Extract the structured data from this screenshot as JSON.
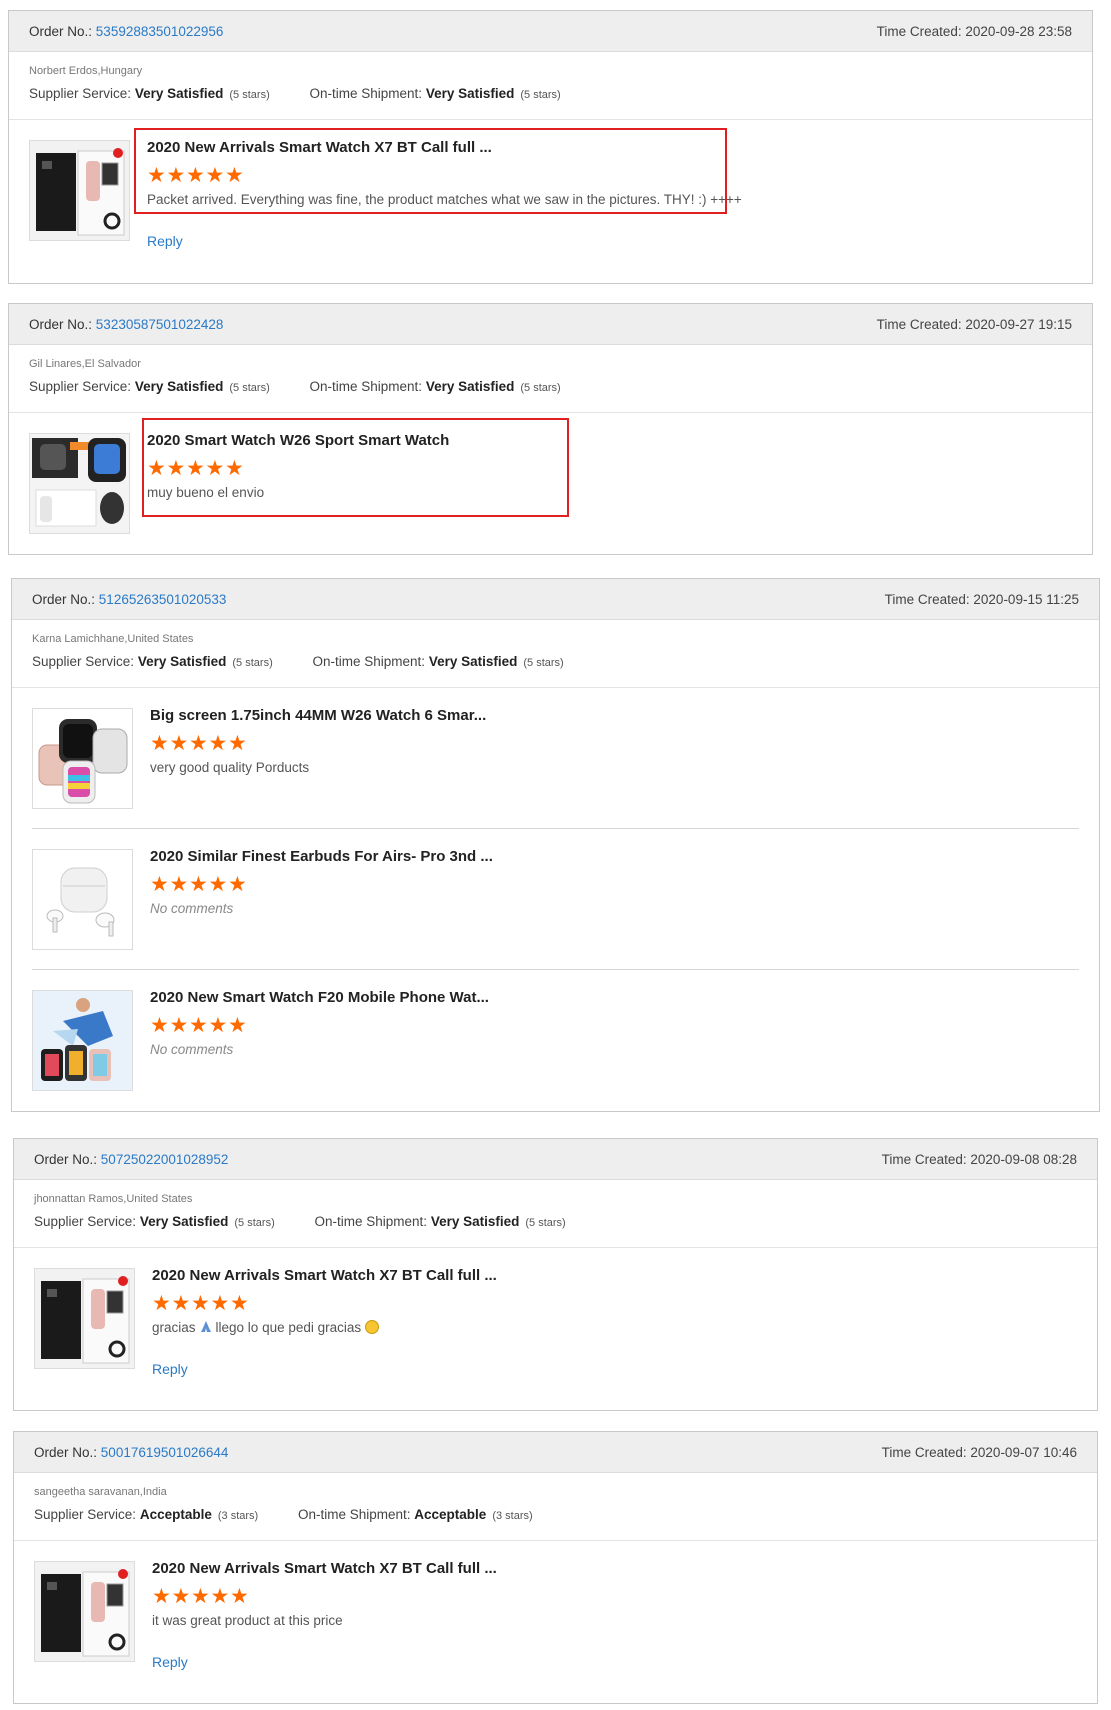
{
  "labels": {
    "order_no": "Order No.:",
    "time_created": "Time Created:",
    "supplier_service": "Supplier Service:",
    "ontime_shipment": "On-time Shipment:",
    "reply": "Reply"
  },
  "colors": {
    "link": "#2a7ac7",
    "star": "#ff6a00",
    "header_bg": "#eeeeee",
    "highlight": "#e02020"
  },
  "orders": [
    {
      "order_no": "53592883501022956",
      "time": "2020-09-28 23:58",
      "buyer": "Norbert Erdos,Hungary",
      "supplier_value": "Very Satisfied",
      "supplier_stars": "(5 stars)",
      "shipment_value": "Very Satisfied",
      "shipment_stars": "(5 stars)",
      "products": [
        {
          "title": "2020 New Arrivals Smart Watch X7 BT Call full ...",
          "rating": 5,
          "comment": "Packet arrived. Everything was fine, the product matches what we saw in the pictures. THY! :) ++++",
          "image_icon": "smartwatch-box-icon"
        }
      ]
    },
    {
      "order_no": "53230587501022428",
      "time": "2020-09-27 19:15",
      "buyer": "Gil Linares,El Salvador",
      "supplier_value": "Very Satisfied",
      "supplier_stars": "(5 stars)",
      "shipment_value": "Very Satisfied",
      "shipment_stars": "(5 stars)",
      "products": [
        {
          "title": "2020 Smart Watch W26 Sport Smart Watch",
          "rating": 5,
          "comment": "muy bueno el envio",
          "image_icon": "smartwatch-package-icon"
        }
      ]
    },
    {
      "order_no": "51265263501020533",
      "time": "2020-09-15 11:25",
      "buyer": "Karna Lamichhane,United States",
      "supplier_value": "Very Satisfied",
      "supplier_stars": "(5 stars)",
      "shipment_value": "Very Satisfied",
      "shipment_stars": "(5 stars)",
      "products": [
        {
          "title": "Big screen 1.75inch 44MM W26 Watch 6 Smar...",
          "rating": 5,
          "comment": "very good quality Porducts",
          "image_icon": "smartwatches-icon"
        },
        {
          "title": "2020 Similar Finest Earbuds For Airs- Pro 3nd ...",
          "rating": 5,
          "comment": "No comments",
          "image_icon": "earbuds-icon"
        },
        {
          "title": "2020 New Smart Watch F20 Mobile Phone Wat...",
          "rating": 5,
          "comment": "No comments",
          "image_icon": "smartwatch-sport-icon"
        }
      ]
    },
    {
      "order_no": "50725022001028952",
      "time": "2020-09-08 08:28",
      "buyer": "jhonnattan Ramos,United States",
      "supplier_value": "Very Satisfied",
      "supplier_stars": "(5 stars)",
      "shipment_value": "Very Satisfied",
      "shipment_stars": "(5 stars)",
      "products": [
        {
          "title": "2020 New Arrivals Smart Watch X7 BT Call full ...",
          "rating": 5,
          "comment_before": "gracias",
          "comment_after": "llego lo que pedi gracias",
          "image_icon": "smartwatch-box-icon"
        }
      ]
    },
    {
      "order_no": "50017619501026644",
      "time": "2020-09-07 10:46",
      "buyer": "sangeetha saravanan,India",
      "supplier_value": "Acceptable",
      "supplier_stars": "(3 stars)",
      "shipment_value": "Acceptable",
      "shipment_stars": "(3 stars)",
      "products": [
        {
          "title": "2020 New Arrivals Smart Watch X7 BT Call full ...",
          "rating": 5,
          "comment": "it was great product at this price",
          "image_icon": "smartwatch-box-icon"
        }
      ]
    }
  ]
}
